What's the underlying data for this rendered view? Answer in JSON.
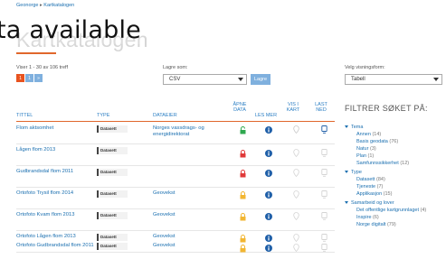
{
  "breadcrumb": {
    "home": "Geonorge",
    "separator": "▸",
    "current": "Kartkatalogen"
  },
  "page": {
    "title": "Kartkatalogen",
    "overlay": "ta available"
  },
  "results": {
    "count_text": "Viser 1 - 30 av 106 treff"
  },
  "pager": [
    "1",
    "1",
    "»"
  ],
  "save": {
    "label": "Lagre som:",
    "value": "CSV",
    "button": "Lagre"
  },
  "view": {
    "label": "Velg visningsform:",
    "value": "Tabell"
  },
  "table": {
    "headers": {
      "title": "TITTEL",
      "type": "TYPE",
      "owner": "DATAEIER",
      "open": "ÅPNE DATA",
      "more": "LES MER",
      "map": "VIS I KART",
      "download": "LAST NED"
    },
    "rows": [
      {
        "title": "Flom aktsomhet",
        "type": "Datasett",
        "owner": "Norges vassdrags- og energidirektorat",
        "lock": "open"
      },
      {
        "title": "Lågen flom 2013",
        "type": "Datasett",
        "owner": "",
        "lock": "closed"
      },
      {
        "title": "Gudbrandsdal flom 2011",
        "type": "Datasett",
        "owner": "",
        "lock": "closed"
      },
      {
        "title": "Ortofoto Trysil flom 2014",
        "type": "Datasett",
        "owner": "Geovekst",
        "lock": "restricted"
      },
      {
        "title": "Ortofoto Kvam flom 2013",
        "type": "Datasett",
        "owner": "Geovekst",
        "lock": "restricted"
      },
      {
        "title": "Ortofoto Lågen flom 2013",
        "type": "Datasett",
        "owner": "Geovekst",
        "lock": "restricted"
      },
      {
        "title": "Ortofoto Gudbrandsdal flom 2011",
        "type": "Datasett",
        "owner": "Geovekst",
        "lock": "restricted"
      }
    ]
  },
  "filters": {
    "heading": "FILTRER SØKET PÅ:",
    "groups": [
      {
        "name": "Tema",
        "items": [
          {
            "label": "Annen",
            "count": "(14)"
          },
          {
            "label": "Basis geodata",
            "count": "(76)"
          },
          {
            "label": "Natur",
            "count": "(3)"
          },
          {
            "label": "Plan",
            "count": "(1)"
          },
          {
            "label": "Samfunnssikkerhet",
            "count": "(12)"
          }
        ]
      },
      {
        "name": "Type",
        "items": [
          {
            "label": "Datasett",
            "count": "(84)"
          },
          {
            "label": "Tjeneste",
            "count": "(7)"
          },
          {
            "label": "Applikasjon",
            "count": "(15)"
          }
        ]
      },
      {
        "name": "Samarbeid og lover",
        "items": [
          {
            "label": "Det offentlige kartgrunnlaget",
            "count": "(4)"
          },
          {
            "label": "Inspire",
            "count": "(6)"
          },
          {
            "label": "Norge digitalt",
            "count": "(79)"
          }
        ]
      }
    ]
  },
  "colors": {
    "accent": "#e0672c",
    "link": "#1a6fb0",
    "open_lock": "#2fa84f",
    "closed_lock": "#e03a3a",
    "restricted_lock": "#f2b632",
    "info": "#1f5fa8"
  }
}
